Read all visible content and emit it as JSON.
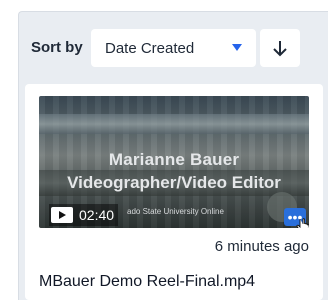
{
  "sort": {
    "label": "Sort by",
    "selected": "Date Created",
    "direction_icon": "arrow-down-icon"
  },
  "media": {
    "title_overlay_line1": "Marianne Bauer",
    "title_overlay_line2": "Videographer/Video Editor",
    "org_overlay": "ado State University Online",
    "duration": "02:40",
    "time_ago": "6 minutes ago",
    "filename": "MBauer Demo Reel-Final.mp4",
    "more_glyph": "•••"
  },
  "colors": {
    "accent": "#2a6fdb",
    "panel_bg": "#e9edf2"
  }
}
